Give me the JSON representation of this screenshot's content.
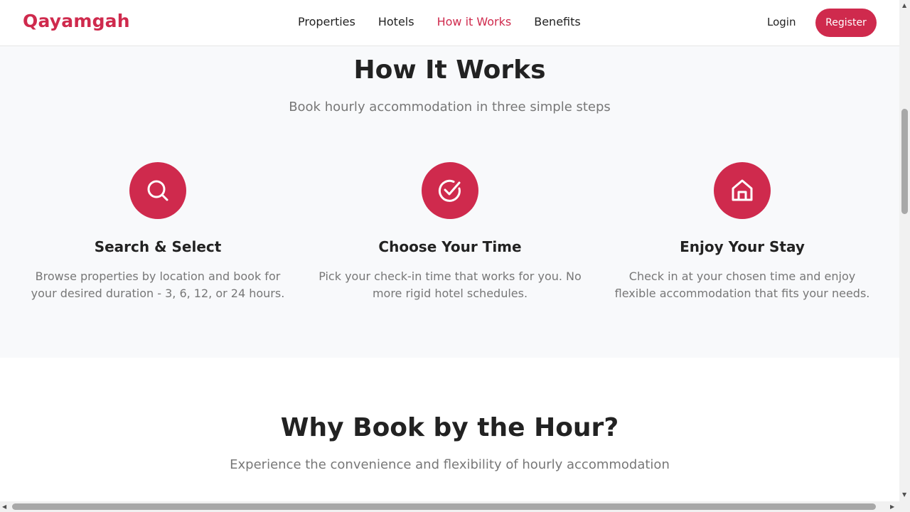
{
  "header": {
    "logo": "Qayamgah",
    "nav": [
      "Properties",
      "Hotels",
      "How it Works",
      "Benefits"
    ],
    "active_nav": "How it Works",
    "login_label": "Login",
    "register_label": "Register"
  },
  "how_it_works": {
    "title": "How It Works",
    "subtitle": "Book hourly accommodation in three simple steps",
    "steps": [
      {
        "icon": "search-icon",
        "title": "Search & Select",
        "description": "Browse properties by location and book for your desired duration - 3, 6, 12, or 24 hours."
      },
      {
        "icon": "check-circle-icon",
        "title": "Choose Your Time",
        "description": "Pick your check-in time that works for you. No more rigid hotel schedules."
      },
      {
        "icon": "home-icon",
        "title": "Enjoy Your Stay",
        "description": "Check in at your chosen time and enjoy flexible accommodation that fits your needs."
      }
    ]
  },
  "why": {
    "title": "Why Book by the Hour?",
    "subtitle": "Experience the convenience and flexibility of hourly accommodation"
  },
  "colors": {
    "brand": "#cf2a4d",
    "section_bg": "#f8f9fb",
    "muted_text": "#777777"
  }
}
